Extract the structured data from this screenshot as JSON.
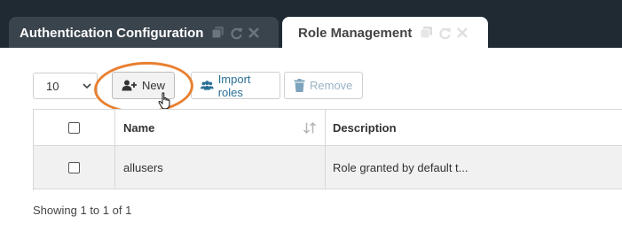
{
  "tabs": [
    {
      "label": "Authentication Configuration",
      "icons": [
        "copy-icon",
        "refresh-icon",
        "close-icon"
      ]
    },
    {
      "label": "Role Management",
      "icons": [
        "copy-icon",
        "refresh-icon",
        "close-icon"
      ]
    }
  ],
  "toolbar": {
    "page_size": "10",
    "new_label": "New",
    "import_label": "Import roles",
    "remove_label": "Remove"
  },
  "table": {
    "columns": [
      "Name",
      "Description"
    ],
    "rows": [
      {
        "name": "allusers",
        "description": "Role granted by default t..."
      }
    ]
  },
  "footer": {
    "summary": "Showing 1 to 1 of 1"
  },
  "colors": {
    "topbar": "#1f2a33",
    "inactive_tab": "#3a444d",
    "highlight": "#e88030",
    "accent": "#2a6f96"
  }
}
